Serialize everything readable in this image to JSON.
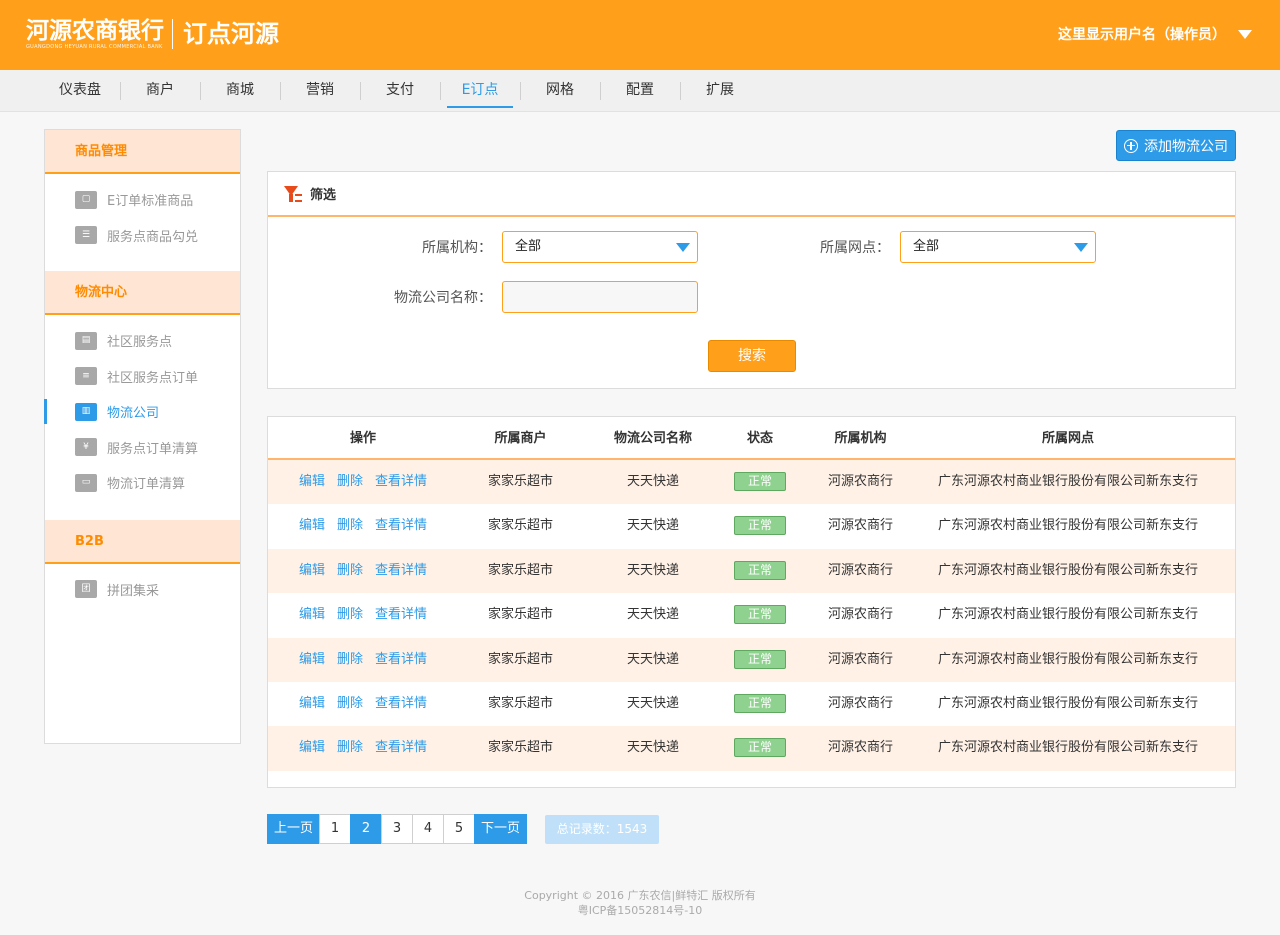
{
  "header": {
    "logo_cn": "河源农商银行",
    "logo_en": "GUANGDONG HEYUAN RURAL COMMERCIAL BANK",
    "logo_sub": "订点河源",
    "username": "这里显示用户名（操作员）",
    "brand_color": "#ff9f1a"
  },
  "nav": {
    "items": [
      {
        "label": "仪表盘"
      },
      {
        "label": "商户"
      },
      {
        "label": "商城"
      },
      {
        "label": "营销"
      },
      {
        "label": "支付"
      },
      {
        "label": "E订点"
      },
      {
        "label": "网格"
      },
      {
        "label": "配置"
      },
      {
        "label": "扩展"
      }
    ],
    "active": "E订点",
    "accent_color": "#2d9be8"
  },
  "sidebar": {
    "groups": [
      {
        "title": "商品管理",
        "items": [
          {
            "label": "E订单标准商品",
            "icon": "bag-icon"
          },
          {
            "label": "服务点商品勾兑",
            "icon": "list-icon"
          }
        ]
      },
      {
        "title": "物流中心",
        "items": [
          {
            "label": "社区服务点",
            "icon": "store-icon"
          },
          {
            "label": "社区服务点订单",
            "icon": "order-icon"
          },
          {
            "label": "物流公司",
            "icon": "building-icon",
            "active": true
          },
          {
            "label": "服务点订单清算",
            "icon": "yen-icon"
          },
          {
            "label": "物流订单清算",
            "icon": "truck-icon"
          }
        ]
      },
      {
        "title": "B2B",
        "items": [
          {
            "label": "拼团集采",
            "icon": "group-icon"
          }
        ]
      }
    ]
  },
  "toolbar": {
    "add_label": "添加物流公司"
  },
  "filter": {
    "title": "筛选",
    "org_label": "所属机构：",
    "org_value": "全部",
    "branch_label": "所属网点：",
    "branch_value": "全部",
    "company_label": "物流公司名称：",
    "company_value": "",
    "search_label": "搜索"
  },
  "table": {
    "headers": [
      "操作",
      "所属商户",
      "物流公司名称",
      "状态",
      "所属机构",
      "所属网点"
    ],
    "actions": {
      "edit": "编辑",
      "delete": "删除",
      "detail": "查看详情"
    },
    "rows": [
      {
        "merchant": "家家乐超市",
        "company": "天天快递",
        "status": "正常",
        "org": "河源农商行",
        "branch": "广东河源农村商业银行股份有限公司新东支行"
      },
      {
        "merchant": "家家乐超市",
        "company": "天天快递",
        "status": "正常",
        "org": "河源农商行",
        "branch": "广东河源农村商业银行股份有限公司新东支行"
      },
      {
        "merchant": "家家乐超市",
        "company": "天天快递",
        "status": "正常",
        "org": "河源农商行",
        "branch": "广东河源农村商业银行股份有限公司新东支行"
      },
      {
        "merchant": "家家乐超市",
        "company": "天天快递",
        "status": "正常",
        "org": "河源农商行",
        "branch": "广东河源农村商业银行股份有限公司新东支行"
      },
      {
        "merchant": "家家乐超市",
        "company": "天天快递",
        "status": "正常",
        "org": "河源农商行",
        "branch": "广东河源农村商业银行股份有限公司新东支行"
      },
      {
        "merchant": "家家乐超市",
        "company": "天天快递",
        "status": "正常",
        "org": "河源农商行",
        "branch": "广东河源农村商业银行股份有限公司新东支行"
      },
      {
        "merchant": "家家乐超市",
        "company": "天天快递",
        "status": "正常",
        "org": "河源农商行",
        "branch": "广东河源农村商业银行股份有限公司新东支行"
      }
    ],
    "status_color": "#8fd18f"
  },
  "pagination": {
    "prev": "上一页",
    "next": "下一页",
    "pages": [
      "1",
      "2",
      "3",
      "4",
      "5"
    ],
    "current": "2",
    "total_label": "总记录数：",
    "total": "1543"
  },
  "footer": {
    "line1": "Copyright © 2016 广东农信|鲜特汇 版权所有",
    "line2": "粤ICP备15052814号-10"
  }
}
